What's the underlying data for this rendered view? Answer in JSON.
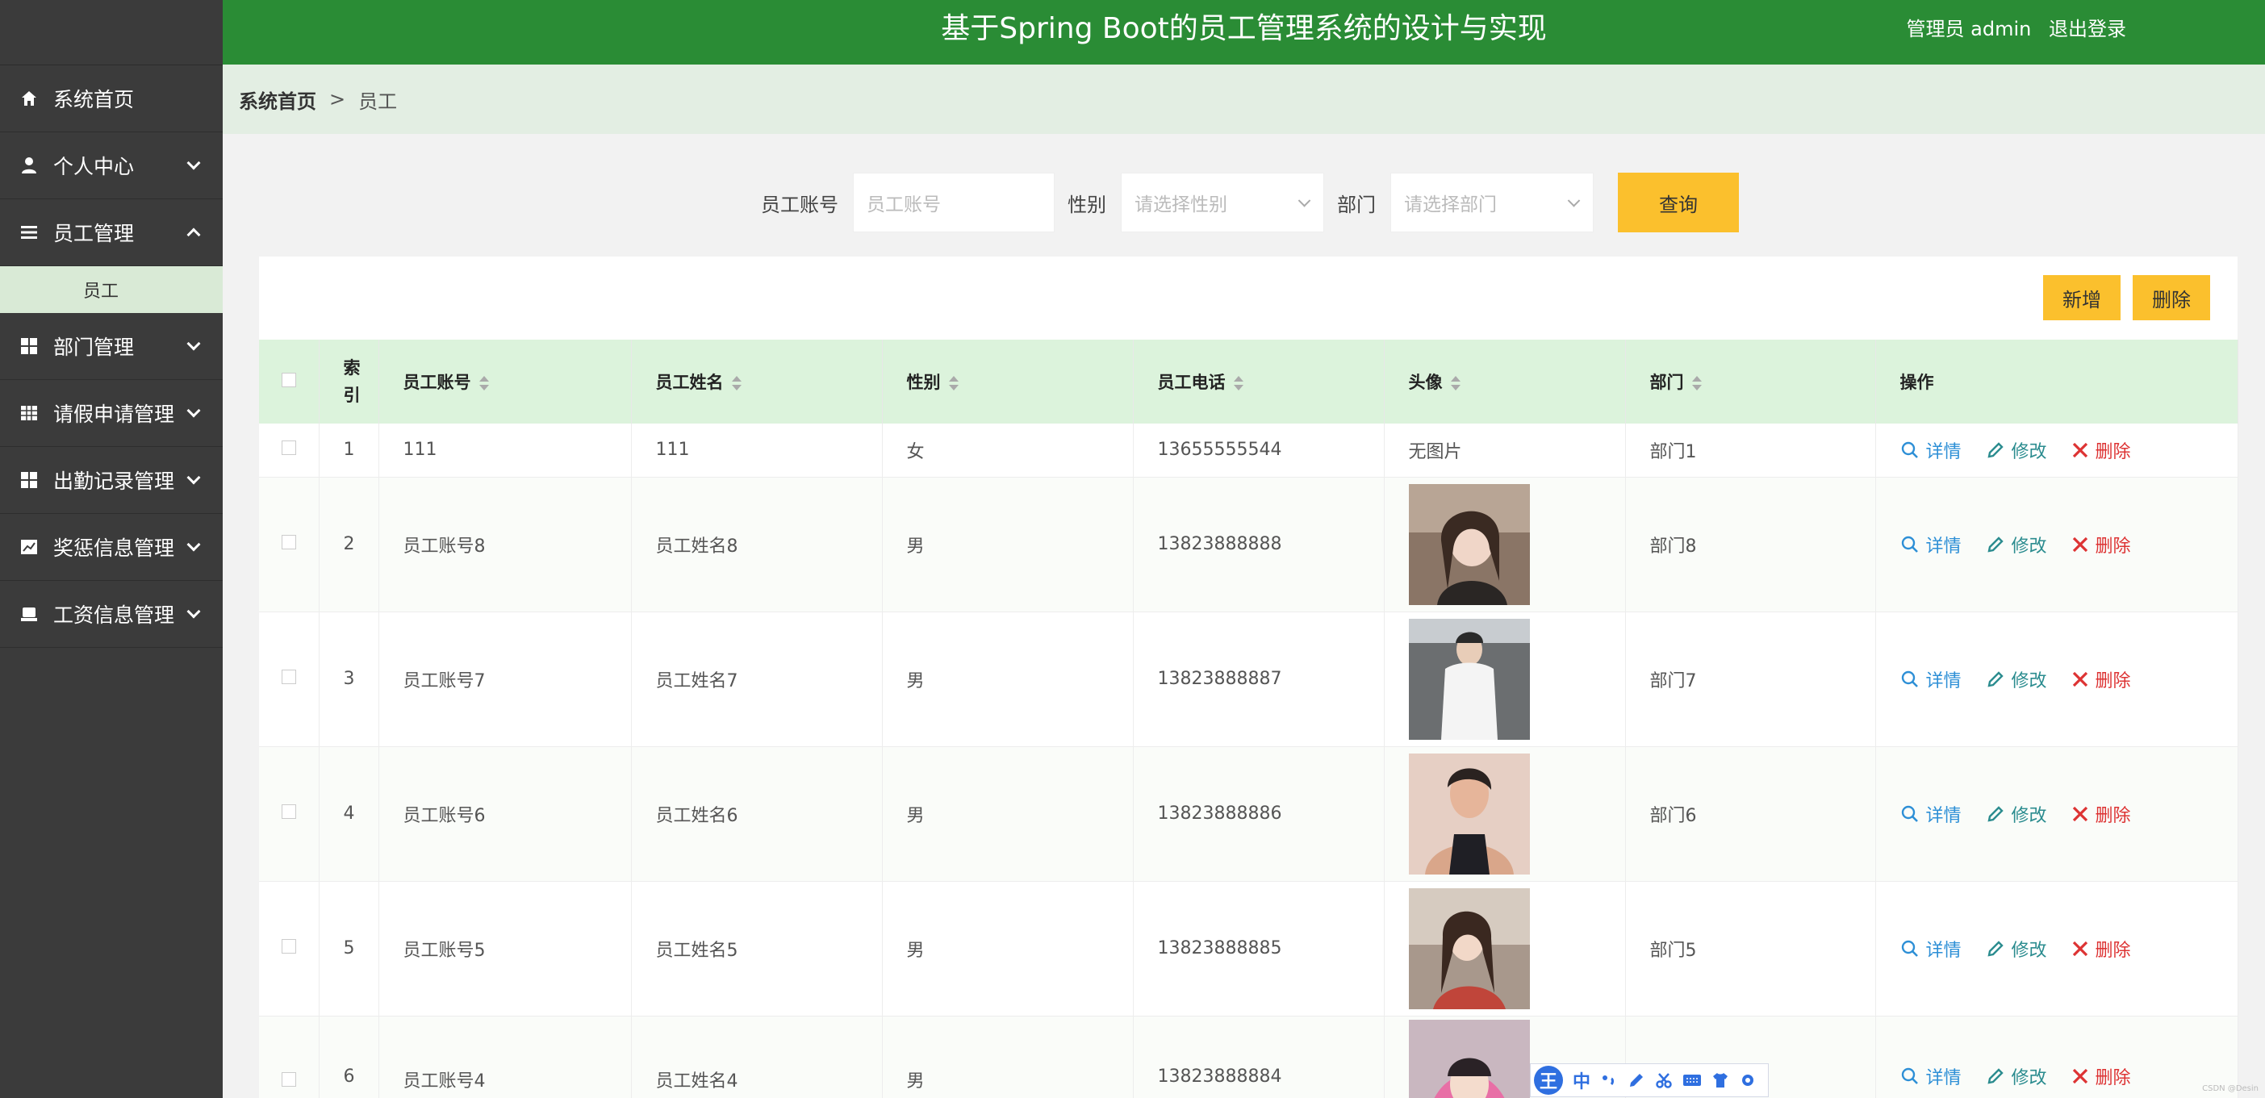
{
  "header": {
    "title": "基于Spring Boot的员工管理系统的设计与实现",
    "user": "管理员 admin",
    "logout": "退出登录"
  },
  "sidebar": {
    "items": [
      {
        "label": "系统首页",
        "icon": "home-icon"
      },
      {
        "label": "个人中心",
        "icon": "user-icon"
      },
      {
        "label": "员工管理",
        "icon": "list-icon",
        "expanded": true,
        "children": [
          "员工"
        ]
      },
      {
        "label": "部门管理",
        "icon": "grid-icon"
      },
      {
        "label": "请假申请管理",
        "icon": "table-icon"
      },
      {
        "label": "出勤记录管理",
        "icon": "grid-icon"
      },
      {
        "label": "奖惩信息管理",
        "icon": "chart-icon"
      },
      {
        "label": "工资信息管理",
        "icon": "money-icon"
      }
    ]
  },
  "breadcrumb": {
    "home": "系统首页",
    "separator": ">",
    "current": "员工"
  },
  "search": {
    "account_label": "员工账号",
    "account_placeholder": "员工账号",
    "gender_label": "性别",
    "gender_placeholder": "请选择性别",
    "dept_label": "部门",
    "dept_placeholder": "请选择部门",
    "query_button": "查询"
  },
  "toolbar": {
    "add": "新增",
    "delete": "删除"
  },
  "table": {
    "headers": {
      "index": "索引",
      "account": "员工账号",
      "name": "员工姓名",
      "gender": "性别",
      "phone": "员工电话",
      "avatar": "头像",
      "dept": "部门",
      "actions": "操作"
    },
    "actions": {
      "detail": "详情",
      "edit": "修改",
      "delete": "删除"
    },
    "no_image": "无图片",
    "rows": [
      {
        "index": "1",
        "account": "111",
        "name": "111",
        "gender": "女",
        "phone": "13655555544",
        "avatar": "",
        "dept": "部门1"
      },
      {
        "index": "2",
        "account": "员工账号8",
        "name": "员工姓名8",
        "gender": "男",
        "phone": "13823888888",
        "avatar": "photo",
        "dept": "部门8"
      },
      {
        "index": "3",
        "account": "员工账号7",
        "name": "员工姓名7",
        "gender": "男",
        "phone": "13823888887",
        "avatar": "photo",
        "dept": "部门7"
      },
      {
        "index": "4",
        "account": "员工账号6",
        "name": "员工姓名6",
        "gender": "男",
        "phone": "13823888886",
        "avatar": "photo",
        "dept": "部门6"
      },
      {
        "index": "5",
        "account": "员工账号5",
        "name": "员工姓名5",
        "gender": "男",
        "phone": "13823888885",
        "avatar": "photo",
        "dept": "部门5"
      },
      {
        "index": "6",
        "account": "员工账号4",
        "name": "员工姓名4",
        "gender": "男",
        "phone": "13823888884",
        "avatar": "photo",
        "dept": ""
      }
    ]
  },
  "ime": {
    "logo": "王",
    "items": [
      "中"
    ]
  },
  "watermark": "CSDN @Desin",
  "colors": {
    "header": "#2a8c35",
    "sidebar": "#3b3b3b",
    "accent": "#fbc02d",
    "table_header": "#dcf3dc"
  }
}
